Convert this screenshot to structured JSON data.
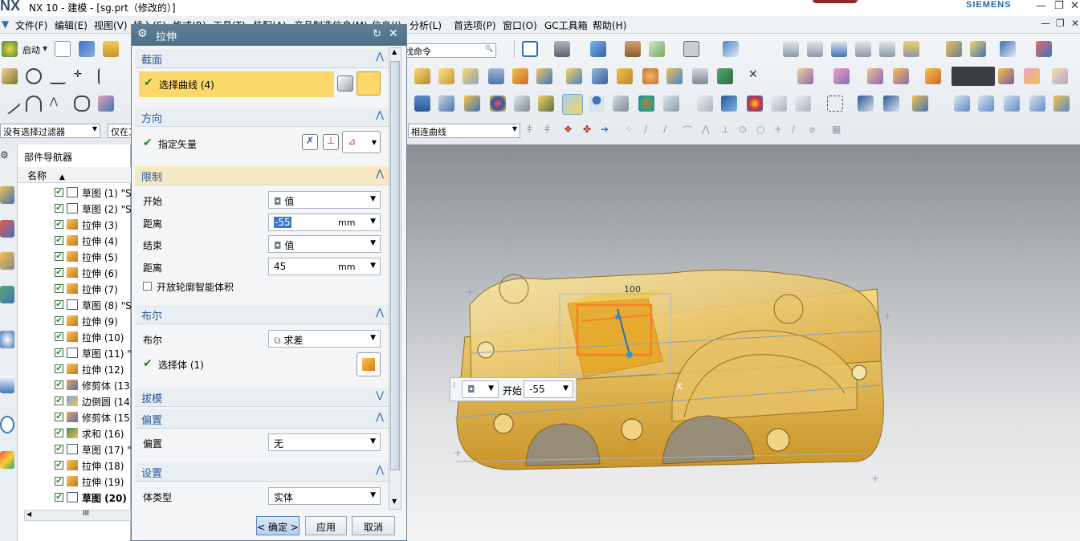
{
  "window": {
    "logo": "NX",
    "title": "NX 10 - 建模 - [sg.prt（修改的）]",
    "brand": "SIEMENS",
    "min": "—",
    "restore": "❐",
    "close": "✕"
  },
  "menu": [
    "文件(F)",
    "编辑(E)",
    "视图(V)",
    "插入(S)",
    "格式(R)",
    "工具(T)",
    "装配(A)",
    "产品制造信息(M)",
    "信息(I)",
    "分析(L)",
    "首选项(P)",
    "窗口(O)",
    "GC工具箱",
    "帮助(H)"
  ],
  "toolbar": {
    "start_label": "启动",
    "filter_value": "没有选择过滤器",
    "scope_value": "仅在工",
    "find_command": "找命令",
    "curve_rule": "相连曲线"
  },
  "navigator": {
    "title": "部件导航器",
    "column": "名称",
    "items": [
      {
        "label": "草图 (1) \"S",
        "type": "sketch",
        "bold": false
      },
      {
        "label": "草图 (2) \"S",
        "type": "sketch",
        "bold": false
      },
      {
        "label": "拉伸 (3)",
        "type": "extrude",
        "bold": false
      },
      {
        "label": "拉伸 (4)",
        "type": "extrude",
        "bold": false
      },
      {
        "label": "拉伸 (5)",
        "type": "extrude",
        "bold": false
      },
      {
        "label": "拉伸 (6)",
        "type": "extrude",
        "bold": false
      },
      {
        "label": "拉伸 (7)",
        "type": "extrude",
        "bold": false
      },
      {
        "label": "草图 (8) \"S",
        "type": "sketch",
        "bold": false
      },
      {
        "label": "拉伸 (9)",
        "type": "extrude",
        "bold": false
      },
      {
        "label": "拉伸 (10)",
        "type": "extrude",
        "bold": false
      },
      {
        "label": "草图 (11) \"",
        "type": "sketch",
        "bold": false
      },
      {
        "label": "拉伸 (12)",
        "type": "extrude",
        "bold": false
      },
      {
        "label": "修剪体 (13)",
        "type": "trim",
        "bold": false
      },
      {
        "label": "边倒圆 (14)",
        "type": "blend",
        "bold": false
      },
      {
        "label": "修剪体 (15)",
        "type": "trim",
        "bold": false
      },
      {
        "label": "求和 (16)",
        "type": "unite",
        "bold": false
      },
      {
        "label": "草图 (17) \"",
        "type": "sketch",
        "bold": false
      },
      {
        "label": "拉伸 (18)",
        "type": "extrude",
        "bold": false
      },
      {
        "label": "拉伸 (19)",
        "type": "extrude",
        "bold": false
      },
      {
        "label": "草图 (20) \"",
        "type": "sketch",
        "bold": true
      }
    ],
    "scroll_thumb": "III"
  },
  "dialog": {
    "title": "拉伸",
    "section": {
      "title": "截面",
      "select_curve": "选择曲线 (4)"
    },
    "direction": {
      "title": "方向",
      "specify_vector": "指定矢量"
    },
    "limits": {
      "title": "限制",
      "start_label": "开始",
      "start_value": "值",
      "start_distance_label": "距离",
      "start_distance": "-55",
      "unit": "mm",
      "end_label": "结束",
      "end_value": "值",
      "end_distance_label": "距离",
      "end_distance": "45",
      "open_profile": "开放轮廓智能体积"
    },
    "boolean": {
      "title": "布尔",
      "boolean_label": "布尔",
      "boolean_value": "求差",
      "select_body": "选择体 (1)"
    },
    "draft": {
      "title": "拔模"
    },
    "offset": {
      "title": "偏置",
      "offset_label": "偏置",
      "offset_value": "无"
    },
    "settings": {
      "title": "设置",
      "body_type_label": "体类型",
      "body_type_value": "实体"
    },
    "ok": "< 确定 >",
    "apply": "应用",
    "cancel": "取消"
  },
  "viewport": {
    "dim_label": "100",
    "handle_label": "开始",
    "handle_value": "-55",
    "axis_label": "X"
  },
  "colors": {
    "dialog_title": "#56788f",
    "section_title": "#2a5b9a",
    "highlight": "#fcd86a",
    "part": "#f0c25a",
    "orange": "#f58220",
    "check": "#1e8a1e"
  }
}
